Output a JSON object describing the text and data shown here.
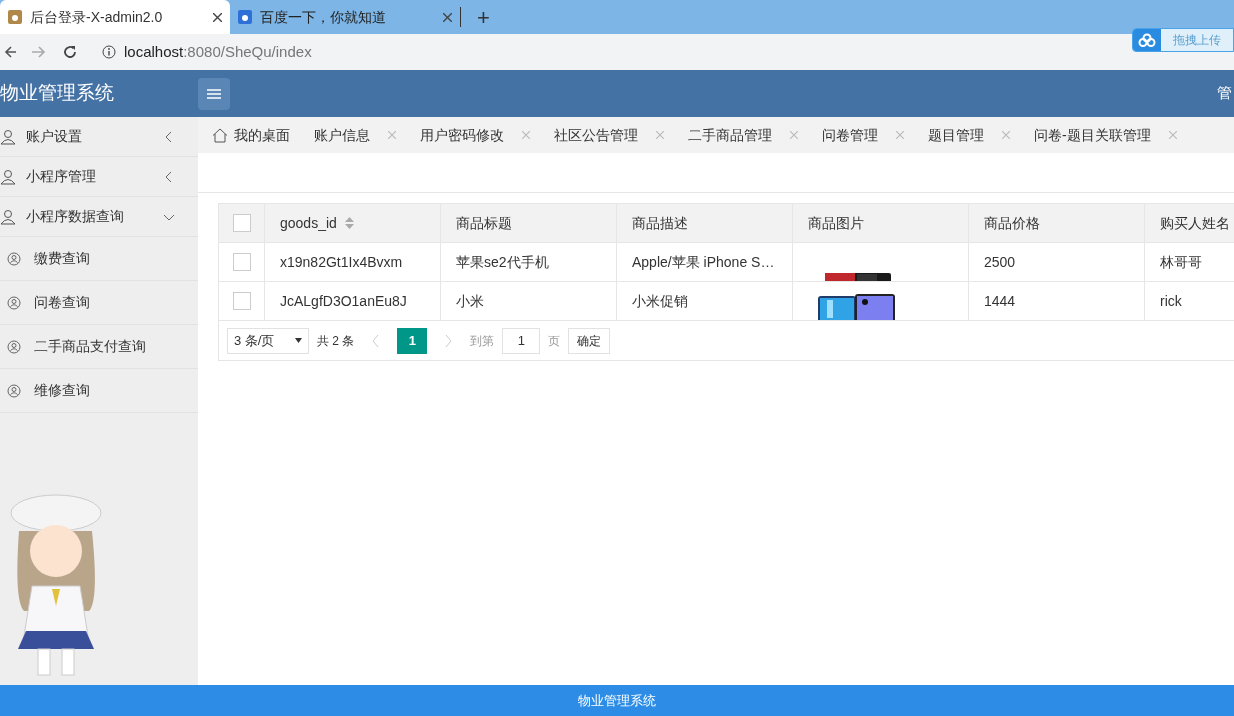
{
  "browser": {
    "tabs": [
      {
        "title": "后台登录-X-admin2.0",
        "selected": true
      },
      {
        "title": "百度一下，你就知道",
        "selected": false
      }
    ],
    "new_tab": "+",
    "url_host": "localhost",
    "url_path": ":8080/SheQu/index",
    "upload_widget": "拖拽上传"
  },
  "header": {
    "title": "物业管理系统",
    "right_text": "管"
  },
  "sidebar": {
    "items": [
      {
        "label": "账户设置",
        "expanded": false
      },
      {
        "label": "小程序管理",
        "expanded": false
      },
      {
        "label": "小程序数据查询",
        "expanded": true,
        "children": [
          {
            "label": "缴费查询"
          },
          {
            "label": "问卷查询"
          },
          {
            "label": "二手商品支付查询"
          },
          {
            "label": "维修查询"
          }
        ]
      }
    ]
  },
  "page_tabs": [
    {
      "label": "我的桌面",
      "kind": "home",
      "selected": false
    },
    {
      "label": "账户信息",
      "kind": "closable",
      "selected": false
    },
    {
      "label": "用户密码修改",
      "kind": "closable",
      "selected": false
    },
    {
      "label": "社区公告管理",
      "kind": "closable",
      "selected": false
    },
    {
      "label": "二手商品管理",
      "kind": "closable",
      "selected": false
    },
    {
      "label": "问卷管理",
      "kind": "closable",
      "selected": false
    },
    {
      "label": "题目管理",
      "kind": "closable",
      "selected": false
    },
    {
      "label": "问卷-题目关联管理",
      "kind": "closable",
      "selected": false
    }
  ],
  "table": {
    "select_all_checked": false,
    "columns": [
      "goods_id",
      "商品标题",
      "商品描述",
      "商品图片",
      "商品价格",
      "购买人姓名"
    ],
    "rows": [
      {
        "checked": false,
        "cells": [
          "x19n82Gt1Ix4Bvxm",
          "苹果se2代手机",
          "Apple/苹果 iPhone S…",
          {
            "kind": "picture"
          },
          "2500",
          "林哥哥"
        ]
      },
      {
        "checked": false,
        "cells": [
          "JcALgfD3O1anEu8J",
          "小米",
          "小米促销",
          {
            "kind": "picture"
          },
          "1444",
          "rick"
        ]
      }
    ]
  },
  "pagination": {
    "page_size": "3 条/页",
    "total": "共 2 条",
    "pages": [
      {
        "label": "1",
        "selected": true
      }
    ],
    "goto_label": "到第",
    "goto_value": "1",
    "page_unit": "页",
    "confirm": "确定"
  },
  "footer": "物业管理系统"
}
